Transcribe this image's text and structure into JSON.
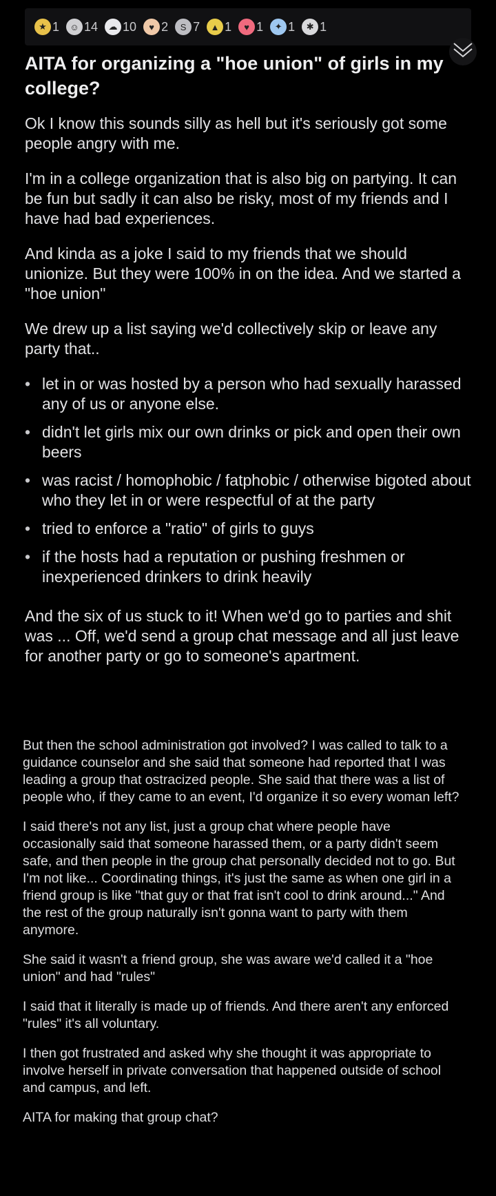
{
  "awards": [
    {
      "icon": "gold-medal-icon",
      "count": "1",
      "color": "#e8c14a",
      "glyph": "★"
    },
    {
      "icon": "wholesome-icon",
      "count": "14",
      "color": "#cfcfd2",
      "glyph": "☺"
    },
    {
      "icon": "cloud-icon",
      "count": "10",
      "color": "#e9e9ec",
      "glyph": "☁"
    },
    {
      "icon": "heart-hug-icon",
      "count": "2",
      "color": "#f0c9a8",
      "glyph": "♥"
    },
    {
      "icon": "silver-coin-icon",
      "count": "7",
      "color": "#bdbdc2",
      "glyph": "S"
    },
    {
      "icon": "helmet-icon",
      "count": "1",
      "color": "#e8cc4a",
      "glyph": "▲"
    },
    {
      "icon": "love-heart-icon",
      "count": "1",
      "color": "#f06a7e",
      "glyph": "♥"
    },
    {
      "icon": "shield-face-icon",
      "count": "1",
      "color": "#9ec7f0",
      "glyph": "✦"
    },
    {
      "icon": "crowd-icon",
      "count": "1",
      "color": "#d8d8db",
      "glyph": "✱"
    }
  ],
  "post": {
    "title": "AITA for organizing a \"hoe union\" of girls in my college?",
    "p1": "Ok I know this sounds silly as hell but it's seriously got some people angry with me.",
    "p2": "I'm in a college organization that is also big on partying. It can be fun but sadly it can also be risky, most of my friends and I have had bad experiences.",
    "p3": "And kinda as a joke I said to my friends that we should unionize. But they were 100% in on the idea. And we started a \"hoe union\"",
    "p4": "We drew up a list saying we'd collectively skip or leave any party that..",
    "list": [
      "let in or was hosted by a person who had sexually harassed any of us or anyone else.",
      "didn't let girls mix our own drinks or pick and open their own beers",
      "was racist / homophobic / fatphobic / otherwise bigoted about who they let in or were respectful of at the party",
      "tried to enforce a \"ratio\" of girls to guys",
      "if the hosts had a reputation or pushing freshmen or inexperienced drinkers to drink heavily"
    ],
    "p5": "And the six of us stuck to it! When we'd go to parties and shit was ... Off, we'd send a group chat message and all just leave for another party or go to someone's apartment."
  },
  "update": {
    "p1": "But then the school administration got involved? I was called to talk to a guidance counselor and she said that someone had reported that I was leading a group that ostracized people. She said that there was a list of people who, if they came to an event, I'd organize it so every woman left?",
    "p2": "I said there's not any list, just a group chat where people have occasionally said that someone harassed them, or a party didn't seem safe, and then people in the group chat personally decided not to go. But I'm not like... Coordinating things, it's just the same as when one girl in a friend group is like \"that guy or that frat isn't cool to drink around...\" And the rest of the group naturally isn't gonna want to party with them anymore.",
    "p3": "She said it wasn't a friend group, she was aware we'd called it a \"hoe union\" and had \"rules\"",
    "p4": "I said that it literally is made up of friends. And there aren't any enforced \"rules\" it's all voluntary.",
    "p5": "I then got frustrated and asked why she thought it was appropriate to involve herself in private conversation that happened outside of school and campus, and left.",
    "p6": "AITA for making that group chat?"
  }
}
